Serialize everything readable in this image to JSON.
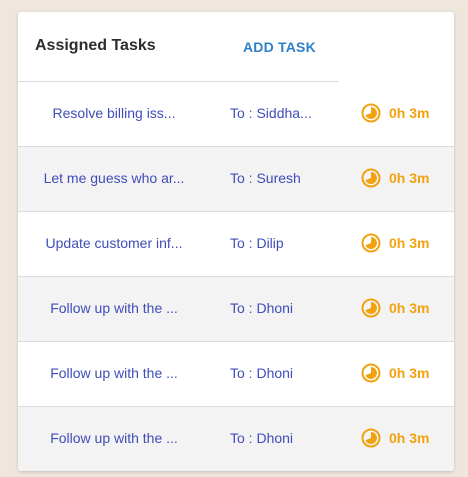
{
  "header": {
    "title": "Assigned Tasks",
    "add_task_label": "ADD TASK"
  },
  "colors": {
    "accent": "#2f80c8",
    "task_text": "#3f4db8",
    "timer": "#f2a20f",
    "row_alt": "#f3f3f3",
    "background": "#efe7de"
  },
  "tasks": [
    {
      "title": "Resolve billing iss...",
      "assignee": "To : Siddha...",
      "time": "0h 3m",
      "icon": "timer-icon"
    },
    {
      "title": "Let me guess who ar...",
      "assignee": "To : Suresh",
      "time": "0h 3m",
      "icon": "timer-icon"
    },
    {
      "title": "Update customer inf...",
      "assignee": "To : Dilip",
      "time": "0h 3m",
      "icon": "timer-icon"
    },
    {
      "title": "Follow up with the ...",
      "assignee": "To : Dhoni",
      "time": "0h 3m",
      "icon": "timer-icon"
    },
    {
      "title": "Follow up with the ...",
      "assignee": "To : Dhoni",
      "time": "0h 3m",
      "icon": "timer-icon"
    },
    {
      "title": "Follow up with the ...",
      "assignee": "To : Dhoni",
      "time": "0h 3m",
      "icon": "timer-icon"
    }
  ]
}
